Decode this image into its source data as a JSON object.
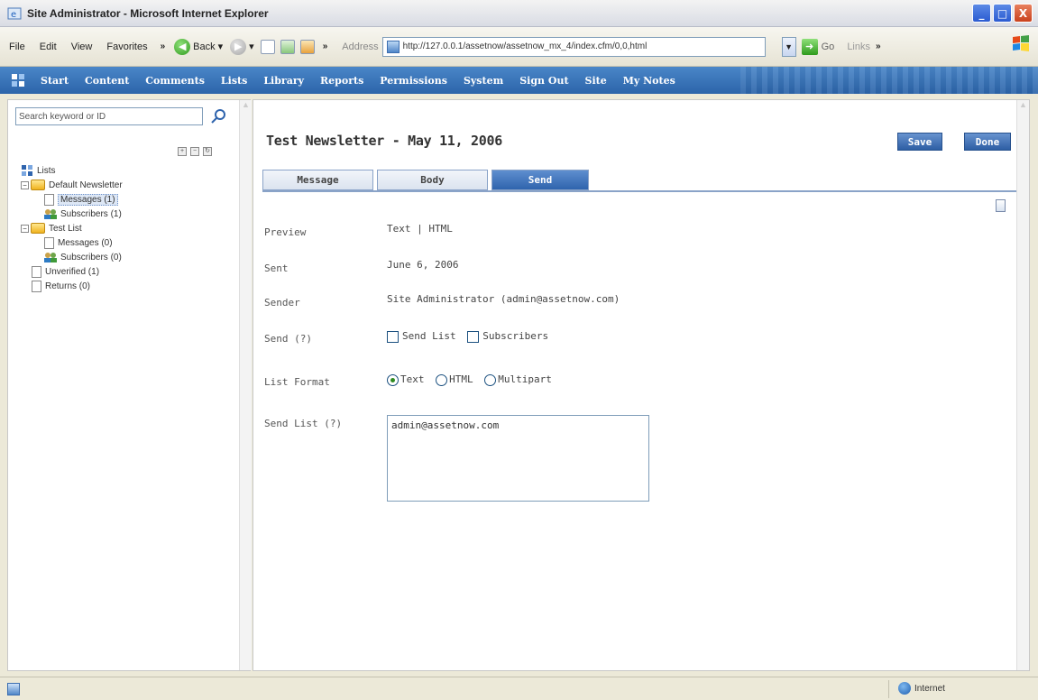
{
  "window": {
    "title": "Site Administrator - Microsoft Internet Explorer",
    "buttons": [
      "_",
      "□",
      "X"
    ]
  },
  "browser": {
    "menu": [
      "File",
      "Edit",
      "View",
      "Favorites"
    ],
    "back_label": "Back",
    "address_label": "Address",
    "address_value": "http://127.0.0.1/assetnow/assetnow_mx_4/index.cfm/0,0,html",
    "go_label": "Go",
    "links_label": "Links"
  },
  "appnav": {
    "items": [
      "Start",
      "Content",
      "Comments",
      "Lists",
      "Library",
      "Reports",
      "Permissions",
      "System",
      "Sign Out",
      "Site",
      "My Notes"
    ]
  },
  "sidebar": {
    "search_value": "Search keyword or ID",
    "tree": {
      "root": "Lists",
      "groups": [
        {
          "label": "Default Newsletter",
          "children": [
            "Messages (1)",
            "Subscribers (1)"
          ]
        },
        {
          "label": "Test List",
          "children": [
            "Messages (0)",
            "Subscribers (0)"
          ]
        }
      ],
      "extras": [
        "Unverified (1)",
        "Returns (0)"
      ]
    }
  },
  "main": {
    "title": "Test Newsletter - May 11, 2006",
    "save_label": "Save",
    "done_label": "Done",
    "tabs": [
      {
        "label": "Message",
        "active": false
      },
      {
        "label": "Body",
        "active": false
      },
      {
        "label": "Send",
        "active": true
      }
    ],
    "fields": {
      "preview_label": "Preview",
      "preview_value": "Text | HTML",
      "sent_label": "Sent",
      "sent_value": "June 6, 2006",
      "sender_label": "Sender",
      "sender_value": "Site Administrator (admin@assetnow.com)",
      "send_label": "Send (?)",
      "send_options": [
        "Send List",
        "Subscribers"
      ],
      "format_label": "List Format",
      "format_options": [
        "Text",
        "HTML",
        "Multipart"
      ],
      "format_selected": "Text",
      "sendlist_label": "Send List (?)",
      "sendlist_value": "admin@assetnow.com"
    }
  },
  "status": {
    "zone_label": "Internet"
  },
  "colors": {
    "nav_blue": "#2c64aa",
    "tab_active": "#2f64ad",
    "window_bg": "#ece9d8"
  }
}
